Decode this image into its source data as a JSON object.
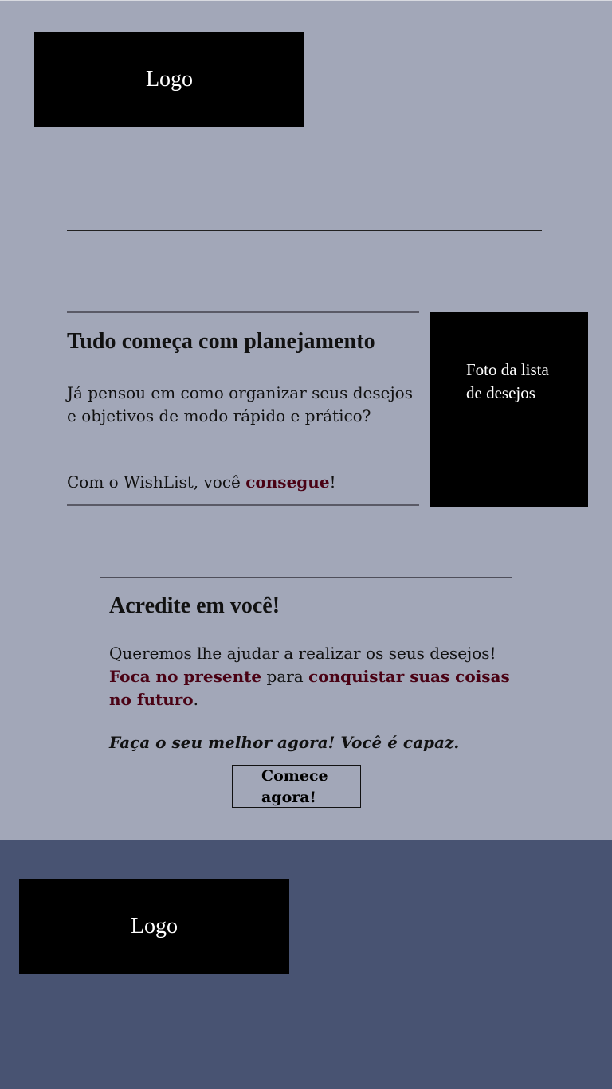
{
  "header": {
    "logo_text": "Logo"
  },
  "planning": {
    "title": "Tudo começa com planejamento",
    "paragraph": "Já pensou em como organizar seus desejos e objetivos de modo rápido e prático?",
    "line2_prefix": "Com o WishList, você ",
    "line2_accent": "consegue",
    "line2_suffix": "!"
  },
  "photo": {
    "label": "Foto da lista de desejos"
  },
  "belief": {
    "title": "Acredite em você!",
    "text_part1": "Queremos lhe ajudar a realizar os seus desejos! ",
    "accent1": "Foca no presente",
    "text_part2": " para ",
    "accent2": "conquistar suas coisas no futuro",
    "text_part3": ".",
    "emphasis": "Faça o seu melhor agora! Você é capaz.",
    "cta_label": "Comece agora!"
  },
  "footer": {
    "logo_text": "Logo"
  },
  "colors": {
    "page_bg": "#a2a7b8",
    "footer_bg": "#485372",
    "accent": "#4a0214",
    "logo_bg": "#000000"
  }
}
